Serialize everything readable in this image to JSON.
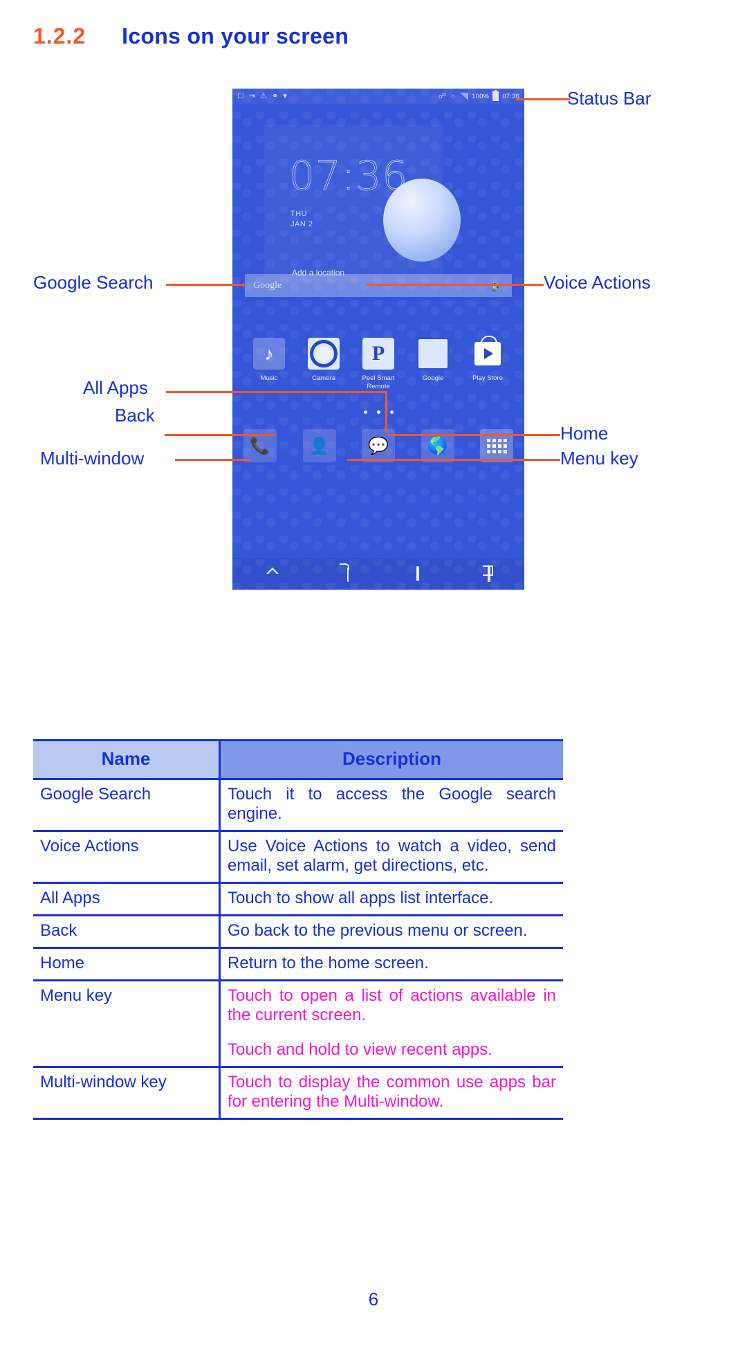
{
  "heading": {
    "section_number": "1.2.2",
    "title": "Icons on your screen"
  },
  "colors": {
    "section_number": "#f4572a",
    "heading_blue": "#1730d6",
    "leader_orange": "#f4572a",
    "magenta": "#f716d4",
    "phone_bg": "#3656d8",
    "table_header_name_bg": "#b9c9f2",
    "table_header_desc_bg": "#8098e8"
  },
  "phone": {
    "status_bar": {
      "left_icons": [
        "sim-card-icon",
        "bluetooth-transfer-icon",
        "warning-icon",
        "usb-debug-icon",
        "wifi-icon"
      ],
      "right_icons": [
        "bluetooth-icon",
        "mute-icon",
        "signal-icon"
      ],
      "battery_percent": "100%",
      "battery_icon": "battery-full-icon",
      "clock": "07:36"
    },
    "clock_widget": {
      "time": "07:36",
      "day": "THU",
      "date": "JAN 2",
      "weather_icon": "weather-moon-icon",
      "add_location": "Add a location"
    },
    "search": {
      "placeholder": "Google",
      "mic_icon": "microphone-icon"
    },
    "apps": [
      {
        "label": "Music",
        "icon": "music-note-icon"
      },
      {
        "label": "Camera",
        "icon": "camera-icon"
      },
      {
        "label": "Peel Smart Remote",
        "icon": "peel-p-icon"
      },
      {
        "label": "Google",
        "icon": "google-folder-icon"
      },
      {
        "label": "Play Store",
        "icon": "play-store-icon"
      }
    ],
    "page_dots": {
      "count": 3,
      "active_index": 1
    },
    "dock": [
      {
        "icon": "phone-icon",
        "name": "dialer"
      },
      {
        "icon": "contacts-icon",
        "name": "contacts"
      },
      {
        "icon": "messages-icon",
        "name": "messaging"
      },
      {
        "icon": "browser-globe-icon",
        "name": "browser"
      },
      {
        "icon": "all-apps-grid-icon",
        "name": "all-apps"
      }
    ],
    "nav_bar": [
      {
        "icon": "multi-window-triangle-icon",
        "name": "multi-window-key"
      },
      {
        "icon": "back-arrow-icon",
        "name": "back-key"
      },
      {
        "icon": "home-icon",
        "name": "home-key"
      },
      {
        "icon": "recent-apps-icon",
        "name": "menu-key"
      }
    ]
  },
  "callouts": {
    "status_bar": "Status Bar",
    "google_search": "Google Search",
    "voice_actions": "Voice Actions",
    "all_apps": "All Apps",
    "back": "Back",
    "multi_window": "Multi-window",
    "home": "Home",
    "menu_key": "Menu key"
  },
  "table": {
    "headers": [
      "Name",
      "Description"
    ],
    "rows": [
      {
        "name": "Google Search",
        "description": [
          "Touch it to access the Google search engine."
        ],
        "description_color": "blue"
      },
      {
        "name": "Voice Actions",
        "description": [
          "Use Voice Actions to watch a video, send email, set alarm, get directions, etc."
        ],
        "description_color": "blue"
      },
      {
        "name": "All Apps",
        "description": [
          "Touch to show all apps list interface."
        ],
        "description_color": "blue"
      },
      {
        "name": "Back",
        "description": [
          "Go back to the previous menu or screen."
        ],
        "description_color": "blue"
      },
      {
        "name": "Home",
        "description": [
          "Return to the home screen."
        ],
        "description_color": "blue"
      },
      {
        "name": "Menu key",
        "description": [
          "Touch to open a list of actions available in the current screen.",
          "Touch and hold to view recent apps."
        ],
        "description_color": "magenta"
      },
      {
        "name": "Multi-window key",
        "description": [
          "Touch to display the common use apps bar for entering the Multi-window."
        ],
        "description_color": "magenta"
      }
    ]
  },
  "page_number": "6"
}
